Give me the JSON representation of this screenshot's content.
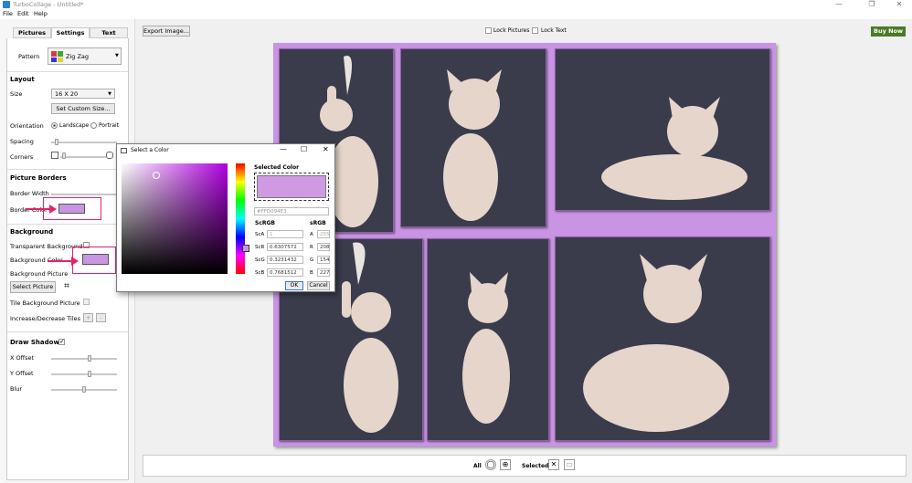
{
  "window": {
    "title": "TurboCollage - Untitled*",
    "minimize": "—",
    "maximize": "❐",
    "close": "✕"
  },
  "menu": [
    "File",
    "Edit",
    "Help"
  ],
  "tabs": [
    "Pictures",
    "Settings",
    "Text"
  ],
  "pattern": {
    "label": "Pattern",
    "value": "Zig Zag"
  },
  "layout": {
    "header": "Layout",
    "size_label": "Size",
    "size_value": "16 X 20",
    "custom_size_button": "Set Custom Size...",
    "orientation_label": "Orientation",
    "landscape": "Landscape",
    "portrait": "Portrait",
    "spacing_label": "Spacing",
    "corners_label": "Corners"
  },
  "borders": {
    "header": "Picture Borders",
    "width_label": "Border Width",
    "color_label": "Border Color",
    "color": "#C994E3"
  },
  "background": {
    "header": "Background",
    "transparent_label": "Transparent Background",
    "color_label": "Background Color",
    "color": "#C994E3",
    "picture_label": "Background Picture",
    "select_picture_button": "Select Picture",
    "tile_label": "Tile Background Picture",
    "tiles_label": "Increase/Decrease Tiles",
    "plus": "+",
    "minus": "-"
  },
  "shadows": {
    "header": "Draw Shadows",
    "x_label": "X Offset",
    "y_label": "Y Offset",
    "blur_label": "Blur"
  },
  "toolbar": {
    "export_button": "Export Image...",
    "lock_pictures": "Lock Pictures",
    "lock_text": "Lock Text",
    "buy_now": "Buy Now"
  },
  "bottom": {
    "all_label": "All",
    "selected_label": "Selected"
  },
  "color_dialog": {
    "title": "Select a Color",
    "selected_color_label": "Selected Color",
    "hex_value": "#FFD094E3",
    "scrgb_header": "ScRGB",
    "srgb_header": "sRGB",
    "rows": [
      {
        "sc_label": "ScA",
        "sc_value": "1",
        "s_label": "A",
        "s_value": "255"
      },
      {
        "sc_label": "ScR",
        "sc_value": "0.6307572",
        "s_label": "R",
        "s_value": "208"
      },
      {
        "sc_label": "ScG",
        "sc_value": "0.3231432",
        "s_label": "G",
        "s_value": "154"
      },
      {
        "sc_label": "ScB",
        "sc_value": "0.7681512",
        "s_label": "B",
        "s_value": "227"
      }
    ],
    "ok_button": "OK",
    "cancel_button": "Cancel"
  },
  "colors": {
    "accent_pink": "#E8206C",
    "canvas_purple": "#C994E3",
    "buy_now_green": "#4A7A25"
  }
}
